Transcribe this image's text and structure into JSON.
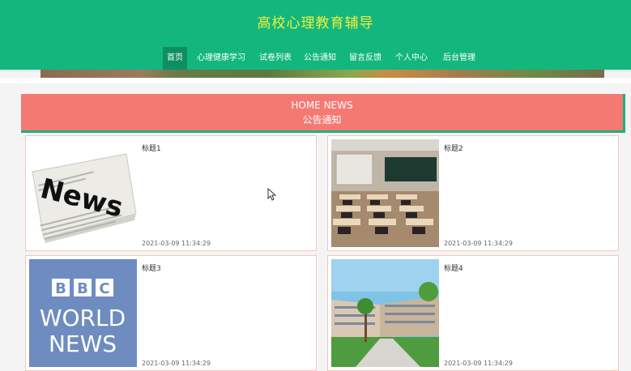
{
  "header": {
    "site_title": "高校心理教育辅导"
  },
  "nav": {
    "items": [
      {
        "label": "首页",
        "active": true
      },
      {
        "label": "心理健康学习",
        "active": false
      },
      {
        "label": "试卷列表",
        "active": false
      },
      {
        "label": "公告通知",
        "active": false
      },
      {
        "label": "留言反馈",
        "active": false
      },
      {
        "label": "个人中心",
        "active": false
      },
      {
        "label": "后台管理",
        "active": false
      }
    ]
  },
  "news_section": {
    "heading_en": "HOME NEWS",
    "heading_cn": "公告通知"
  },
  "cards": [
    {
      "title": "标题1",
      "date": "2021-03-09 11:34:29",
      "image": "newspaper-news"
    },
    {
      "title": "标题2",
      "date": "2021-03-09 11:34:29",
      "image": "classroom"
    },
    {
      "title": "标题3",
      "date": "2021-03-09 11:34:29",
      "image": "bbc-world-news",
      "image_text": [
        "B",
        "B",
        "C",
        "WORLD",
        "NEWS"
      ]
    },
    {
      "title": "标题4",
      "date": "2021-03-09 11:34:29",
      "image": "campus-building"
    }
  ],
  "colors": {
    "header_bg": "#13b77e",
    "title_text": "#f1ef3c",
    "news_header_bg": "#f57973",
    "accent_border": "#1bb17f"
  }
}
